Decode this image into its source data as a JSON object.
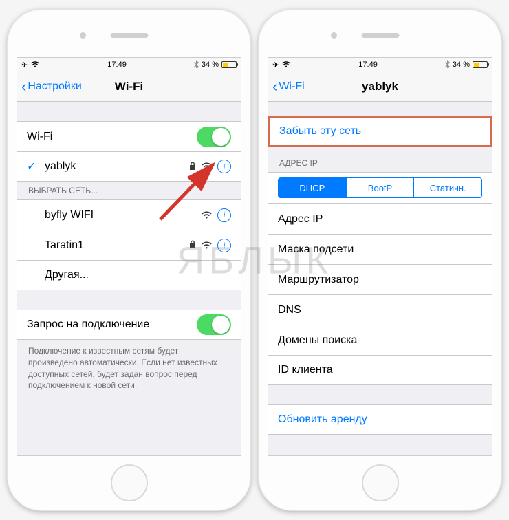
{
  "watermark": "ЯБЛЫК",
  "status_bar": {
    "time": "17:49",
    "battery_pct": "34 %"
  },
  "left": {
    "back_label": "Настройки",
    "title": "Wi-Fi",
    "wifi_row_label": "Wi-Fi",
    "connected_network": "yablyk",
    "choose_header": "ВЫБРАТЬ СЕТЬ...",
    "networks": [
      {
        "name": "byfly WIFI",
        "locked": false
      },
      {
        "name": "Taratin1",
        "locked": true
      }
    ],
    "other_label": "Другая...",
    "ask_join_label": "Запрос на подключение",
    "ask_join_footer": "Подключение к известным сетям будет произведено автоматически. Если нет известных доступных сетей, будет задан вопрос перед подключением к новой сети."
  },
  "right": {
    "back_label": "Wi-Fi",
    "title": "yablyk",
    "forget_label": "Забыть эту сеть",
    "ip_header": "АДРЕС IP",
    "segments": {
      "dhcp": "DHCP",
      "bootp": "BootP",
      "static": "Статичн."
    },
    "rows": {
      "ip": "Адрес IP",
      "mask": "Маска подсети",
      "router": "Маршрутизатор",
      "dns": "DNS",
      "search": "Домены поиска",
      "client": "ID клиента"
    },
    "renew_label": "Обновить аренду"
  }
}
